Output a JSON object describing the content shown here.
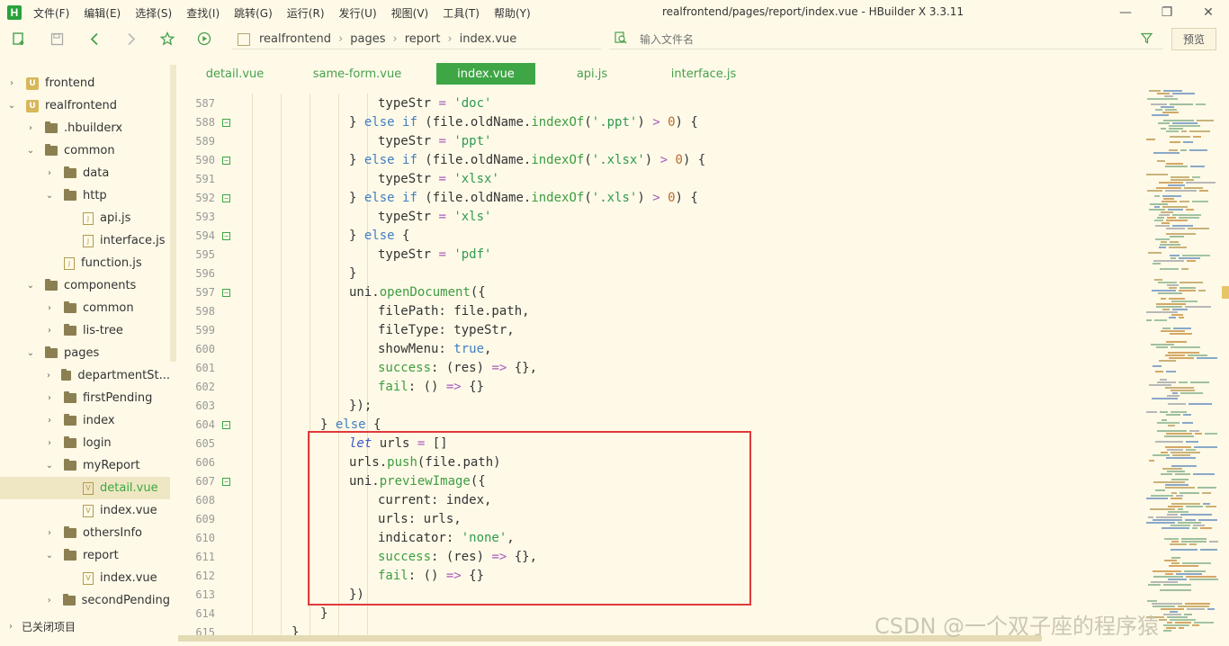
{
  "app": {
    "logo": "H",
    "window_title": "realfrontend/pages/report/index.vue - HBuilder X 3.3.11"
  },
  "menu": [
    "文件(F)",
    "编辑(E)",
    "选择(S)",
    "查找(I)",
    "跳转(G)",
    "运行(R)",
    "发行(U)",
    "视图(V)",
    "工具(T)",
    "帮助(Y)"
  ],
  "window_controls": {
    "minimize": "—",
    "restore": "❐",
    "close": "✕"
  },
  "toolbar": {
    "icons": [
      "new-file-icon",
      "save-icon",
      "back-icon",
      "forward-icon",
      "star-icon",
      "run-icon"
    ],
    "breadcrumb": [
      "realfrontend",
      "pages",
      "report",
      "index.vue"
    ],
    "search_placeholder": "输入文件名",
    "preview_label": "预览"
  },
  "sidebar": {
    "items": [
      {
        "label": "frontend",
        "icon": "project-icon",
        "arrow": "›",
        "indent": 0
      },
      {
        "label": "realfrontend",
        "icon": "project-icon",
        "arrow": "⌄",
        "indent": 0
      },
      {
        "label": ".hbuilderx",
        "icon": "folder-icon",
        "arrow": "›",
        "indent": 1
      },
      {
        "label": "common",
        "icon": "folder-icon",
        "arrow": "⌄",
        "indent": 1
      },
      {
        "label": "data",
        "icon": "folder-icon",
        "arrow": "›",
        "indent": 2
      },
      {
        "label": "http",
        "icon": "folder-icon",
        "arrow": "⌄",
        "indent": 2
      },
      {
        "label": "api.js",
        "icon": "js-file-icon",
        "arrow": "",
        "indent": 3
      },
      {
        "label": "interface.js",
        "icon": "js-file-icon",
        "arrow": "",
        "indent": 3
      },
      {
        "label": "function.js",
        "icon": "js-file-icon",
        "arrow": "",
        "indent": 2
      },
      {
        "label": "components",
        "icon": "folder-icon",
        "arrow": "⌄",
        "indent": 1
      },
      {
        "label": "common",
        "icon": "folder-icon",
        "arrow": "›",
        "indent": 2
      },
      {
        "label": "lis-tree",
        "icon": "folder-icon",
        "arrow": "›",
        "indent": 2
      },
      {
        "label": "pages",
        "icon": "folder-icon",
        "arrow": "⌄",
        "indent": 1
      },
      {
        "label": "departmentSt...",
        "icon": "folder-icon",
        "arrow": "›",
        "indent": 2
      },
      {
        "label": "firstPending",
        "icon": "folder-icon",
        "arrow": "›",
        "indent": 2
      },
      {
        "label": "index",
        "icon": "folder-icon",
        "arrow": "›",
        "indent": 2
      },
      {
        "label": "login",
        "icon": "folder-icon",
        "arrow": "›",
        "indent": 2
      },
      {
        "label": "myReport",
        "icon": "folder-icon",
        "arrow": "⌄",
        "indent": 2
      },
      {
        "label": "detail.vue",
        "icon": "vue-file-icon",
        "arrow": "",
        "indent": 3,
        "selected": true
      },
      {
        "label": "index.vue",
        "icon": "vue-file-icon",
        "arrow": "",
        "indent": 3
      },
      {
        "label": "othersInfo",
        "icon": "folder-icon",
        "arrow": "›",
        "indent": 2
      },
      {
        "label": "report",
        "icon": "folder-icon",
        "arrow": "⌄",
        "indent": 2
      },
      {
        "label": "index.vue",
        "icon": "vue-file-icon",
        "arrow": "",
        "indent": 3
      },
      {
        "label": "secondPending",
        "icon": "folder-icon",
        "arrow": "›",
        "indent": 2
      }
    ],
    "closed_projects": "已关闭项目"
  },
  "tabs": [
    {
      "label": "detail.vue",
      "active": false
    },
    {
      "label": "same-form.vue",
      "active": false
    },
    {
      "label": "index.vue",
      "active": true
    },
    {
      "label": "api.js",
      "active": false
    },
    {
      "label": "interface.js",
      "active": false
    }
  ],
  "code": [
    {
      "n": "587",
      "fold": false,
      "indent": 6,
      "text": "typeStr = 'doc'"
    },
    {
      "n": "588",
      "fold": true,
      "indent": 5,
      "text": "} else if (file.oldName.indexOf('.ppt') > 0) {"
    },
    {
      "n": "589",
      "fold": false,
      "indent": 6,
      "text": "typeStr = 'ppt'"
    },
    {
      "n": "590",
      "fold": true,
      "indent": 5,
      "text": "} else if (file.oldName.indexOf('.xlsx') > 0) {"
    },
    {
      "n": "591",
      "fold": false,
      "indent": 6,
      "text": "typeStr = 'xlsx'"
    },
    {
      "n": "592",
      "fold": true,
      "indent": 5,
      "text": "} else if (file.oldName.indexOf('.xls') > 0) {"
    },
    {
      "n": "593",
      "fold": false,
      "indent": 6,
      "text": "typeStr = 'xls'"
    },
    {
      "n": "594",
      "fold": true,
      "indent": 5,
      "text": "} else {"
    },
    {
      "n": "595",
      "fold": false,
      "indent": 6,
      "text": "typeStr = 'pdf'"
    },
    {
      "n": "596",
      "fold": false,
      "indent": 5,
      "text": "}"
    },
    {
      "n": "597",
      "fold": true,
      "indent": 5,
      "text": "uni.openDocument({"
    },
    {
      "n": "598",
      "fold": false,
      "indent": 6,
      "text": "filePath: file.path,"
    },
    {
      "n": "599",
      "fold": false,
      "indent": 6,
      "text": "fileType: typeStr,"
    },
    {
      "n": "600",
      "fold": false,
      "indent": 6,
      "text": "showMenu: true,"
    },
    {
      "n": "601",
      "fold": false,
      "indent": 6,
      "text": "success: (res) => {},"
    },
    {
      "n": "602",
      "fold": false,
      "indent": 6,
      "text": "fail: () => {}"
    },
    {
      "n": "603",
      "fold": false,
      "indent": 5,
      "text": "});"
    },
    {
      "n": "604",
      "fold": true,
      "indent": 4,
      "text": "} else {"
    },
    {
      "n": "605",
      "fold": false,
      "indent": 5,
      "text": "let urls = []"
    },
    {
      "n": "606",
      "fold": false,
      "indent": 5,
      "text": "urls.push(file.path)"
    },
    {
      "n": "607",
      "fold": true,
      "indent": 5,
      "text": "uni.previewImage({"
    },
    {
      "n": "608",
      "fold": false,
      "indent": 6,
      "text": "current: index,"
    },
    {
      "n": "609",
      "fold": false,
      "indent": 6,
      "text": "urls: urls,"
    },
    {
      "n": "610",
      "fold": false,
      "indent": 6,
      "text": "indicator: 'none',"
    },
    {
      "n": "611",
      "fold": false,
      "indent": 6,
      "text": "success: (res) => {},"
    },
    {
      "n": "612",
      "fold": false,
      "indent": 6,
      "text": "fail: () => {}"
    },
    {
      "n": "613",
      "fold": false,
      "indent": 5,
      "text": "})"
    },
    {
      "n": "614",
      "fold": false,
      "indent": 4,
      "text": "}"
    },
    {
      "n": "615",
      "fold": false,
      "indent": 3,
      "text": "}"
    }
  ],
  "watermark": "CSDN @一个双子座的程序猿",
  "colors": {
    "accent": "#3ea645",
    "background": "#fffae8",
    "highlight_border": "#e03a3a"
  }
}
